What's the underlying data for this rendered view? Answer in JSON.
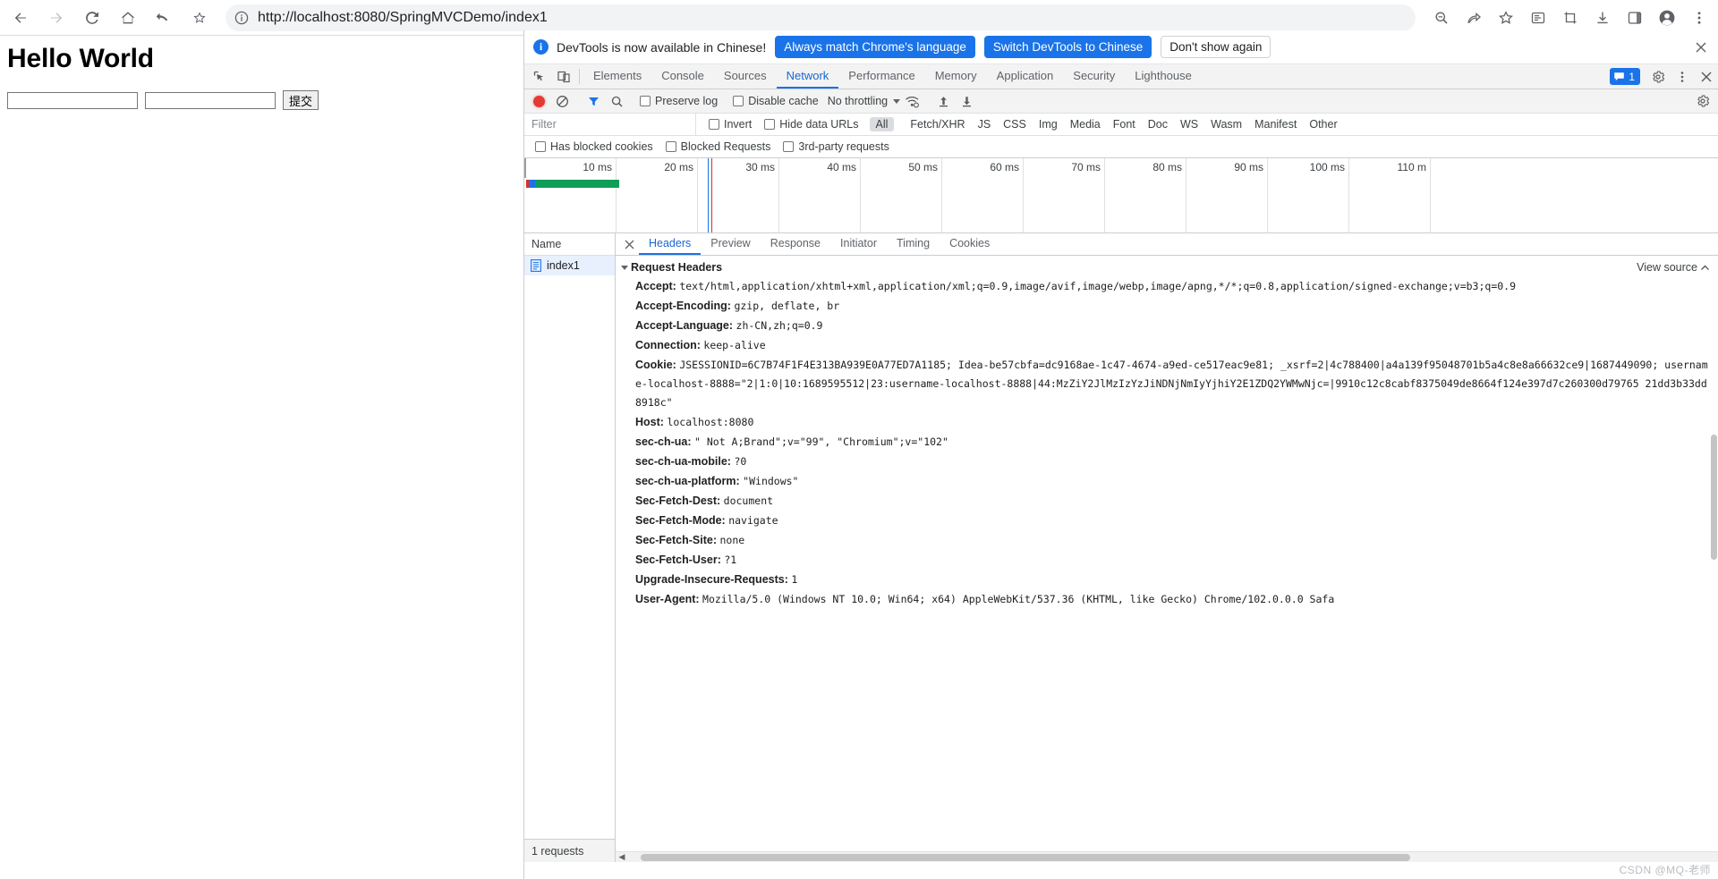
{
  "browser": {
    "nav": [
      {
        "name": "back-button",
        "icon": "arrow-left-icon"
      },
      {
        "name": "forward-button",
        "icon": "arrow-right-icon"
      },
      {
        "name": "reload-button",
        "icon": "reload-icon"
      },
      {
        "name": "home-button",
        "icon": "home-icon"
      },
      {
        "name": "undo-button",
        "icon": "undo-arrow-icon"
      },
      {
        "name": "bookmark-star-button",
        "icon": "star-icon"
      }
    ],
    "omnibox": {
      "info_icon": "info-circle-icon",
      "url": "http://localhost:8080/SpringMVCDemo/index1",
      "url_scheme": "http://",
      "url_host": "localhost:8080",
      "url_path": "/SpringMVCDemo/index1"
    },
    "toolbar_right_icons": [
      "zoom-search-icon",
      "share-icon",
      "star-outline-icon",
      "reading-list-icon",
      "crop-capture-icon",
      "download-icon",
      "side-panel-icon",
      "profile-avatar-icon",
      "three-dot-menu-icon"
    ]
  },
  "page": {
    "heading": "Hello World",
    "field1": {
      "value": "",
      "placeholder": ""
    },
    "field2": {
      "value": "",
      "placeholder": ""
    },
    "submit_label": "提交"
  },
  "devtools": {
    "banner": {
      "icon": "info-circle-icon",
      "message": "DevTools is now available in Chinese!",
      "primary_button": "Always match Chrome's language",
      "secondary_button": "Switch DevTools to Chinese",
      "dismiss_button": "Don't show again",
      "close_icon": "close-icon"
    },
    "tabstrip": {
      "inspect_icon": "inspect-cursor-icon",
      "device_icon": "device-toolbar-icon",
      "tabs": [
        {
          "label": "Elements",
          "active": false
        },
        {
          "label": "Console",
          "active": false
        },
        {
          "label": "Sources",
          "active": false
        },
        {
          "label": "Network",
          "active": true
        },
        {
          "label": "Performance",
          "active": false
        },
        {
          "label": "Memory",
          "active": false
        },
        {
          "label": "Application",
          "active": false
        },
        {
          "label": "Security",
          "active": false
        },
        {
          "label": "Lighthouse",
          "active": false
        }
      ],
      "issues_count": "1",
      "issues_icon": "message-bubble-icon",
      "settings_icon": "gear-icon",
      "more_icon": "three-dot-vertical-icon",
      "close_icon": "close-icon"
    },
    "network_toolbar": {
      "record_button": "record-stop-icon",
      "clear_button": "clear-no-entry-icon",
      "filter_button": "funnel-filter-icon",
      "search_button": "search-icon",
      "preserve_log_label": "Preserve log",
      "preserve_log_checked": false,
      "disable_cache_label": "Disable cache",
      "disable_cache_checked": false,
      "throttling_value": "No throttling",
      "wifi_icon": "wifi-settings-icon",
      "import_icon": "upload-arrow-icon",
      "export_icon": "download-arrow-icon",
      "settings_icon": "gear-icon"
    },
    "filter_bar": {
      "filter_placeholder": "Filter",
      "filter_value": "",
      "invert_label": "Invert",
      "invert_checked": false,
      "hide_data_urls_label": "Hide data URLs",
      "hide_data_urls_checked": false,
      "types": [
        {
          "label": "All",
          "active": true
        },
        {
          "label": "Fetch/XHR",
          "active": false
        },
        {
          "label": "JS",
          "active": false
        },
        {
          "label": "CSS",
          "active": false
        },
        {
          "label": "Img",
          "active": false
        },
        {
          "label": "Media",
          "active": false
        },
        {
          "label": "Font",
          "active": false
        },
        {
          "label": "Doc",
          "active": false
        },
        {
          "label": "WS",
          "active": false
        },
        {
          "label": "Wasm",
          "active": false
        },
        {
          "label": "Manifest",
          "active": false
        },
        {
          "label": "Other",
          "active": false
        }
      ]
    },
    "cookie_bar": {
      "has_blocked_cookies_label": "Has blocked cookies",
      "has_blocked_cookies_checked": false,
      "blocked_requests_label": "Blocked Requests",
      "blocked_requests_checked": false,
      "third_party_label": "3rd-party requests",
      "third_party_checked": false
    },
    "timeline": {
      "ticks": [
        "10 ms",
        "20 ms",
        "30 ms",
        "40 ms",
        "50 ms",
        "60 ms",
        "70 ms",
        "80 ms",
        "90 ms",
        "100 ms",
        "110 m"
      ],
      "bar_colors": [
        "#d93025",
        "#1a73e8",
        "#0f9d58"
      ],
      "markers": [
        {
          "color": "#1a73e8",
          "pos_pct": 15.4
        },
        {
          "color": "#d93025",
          "pos_pct": 15.8
        }
      ]
    },
    "request_list": {
      "header": "Name",
      "rows": [
        {
          "icon": "document-file-icon",
          "name": "index1",
          "selected": true
        }
      ],
      "footer": "1 requests"
    },
    "detail": {
      "close_icon": "close-icon",
      "tabs": [
        {
          "label": "Headers",
          "active": true
        },
        {
          "label": "Preview",
          "active": false
        },
        {
          "label": "Response",
          "active": false
        },
        {
          "label": "Initiator",
          "active": false
        },
        {
          "label": "Timing",
          "active": false
        },
        {
          "label": "Cookies",
          "active": false
        }
      ],
      "view_source_label": "View source",
      "view_source_icon": "chevron-up-icon",
      "section_title": "Request Headers",
      "headers": [
        {
          "name": "Accept:",
          "value": "text/html,application/xhtml+xml,application/xml;q=0.9,image/avif,image/webp,image/apng,*/*;q=0.8,application/signed-exchange;v=b3;q=0.9"
        },
        {
          "name": "Accept-Encoding:",
          "value": "gzip, deflate, br"
        },
        {
          "name": "Accept-Language:",
          "value": "zh-CN,zh;q=0.9"
        },
        {
          "name": "Connection:",
          "value": "keep-alive"
        },
        {
          "name": "Cookie:",
          "value": "JSESSIONID=6C7B74F1F4E313BA939E0A77ED7A1185; Idea-be57cbfa=dc9168ae-1c47-4674-a9ed-ce517eac9e81; _xsrf=2|4c788400|a4a139f95048701b5a4c8e8a66632ce9|1687449090; username-localhost-8888=\"2|1:0|10:1689595512|23:username-localhost-8888|44:MzZiY2JlMzIzYzJiNDNjNmIyYjhiY2E1ZDQ2YWMwNjc=|9910c12c8cabf8375049de8664f124e397d7c260300d79765 21dd3b33dd8918c\""
        },
        {
          "name": "Host:",
          "value": "localhost:8080"
        },
        {
          "name": "sec-ch-ua:",
          "value": "\" Not A;Brand\";v=\"99\", \"Chromium\";v=\"102\""
        },
        {
          "name": "sec-ch-ua-mobile:",
          "value": "?0"
        },
        {
          "name": "sec-ch-ua-platform:",
          "value": "\"Windows\""
        },
        {
          "name": "Sec-Fetch-Dest:",
          "value": "document"
        },
        {
          "name": "Sec-Fetch-Mode:",
          "value": "navigate"
        },
        {
          "name": "Sec-Fetch-Site:",
          "value": "none"
        },
        {
          "name": "Sec-Fetch-User:",
          "value": "?1"
        },
        {
          "name": "Upgrade-Insecure-Requests:",
          "value": "1"
        },
        {
          "name": "User-Agent:",
          "value": "Mozilla/5.0 (Windows NT 10.0; Win64; x64) AppleWebKit/537.36 (KHTML, like Gecko) Chrome/102.0.0.0 Safa"
        }
      ]
    }
  },
  "watermark": "CSDN @MQ-老师",
  "colors": {
    "accent_blue": "#1a73e8",
    "active_tab_blue": "#1967d2",
    "record_red": "#e53935",
    "selected_row": "#e8f0fe",
    "toolbar_grey": "#f3f3f3",
    "border_grey": "#cdcdcd"
  }
}
